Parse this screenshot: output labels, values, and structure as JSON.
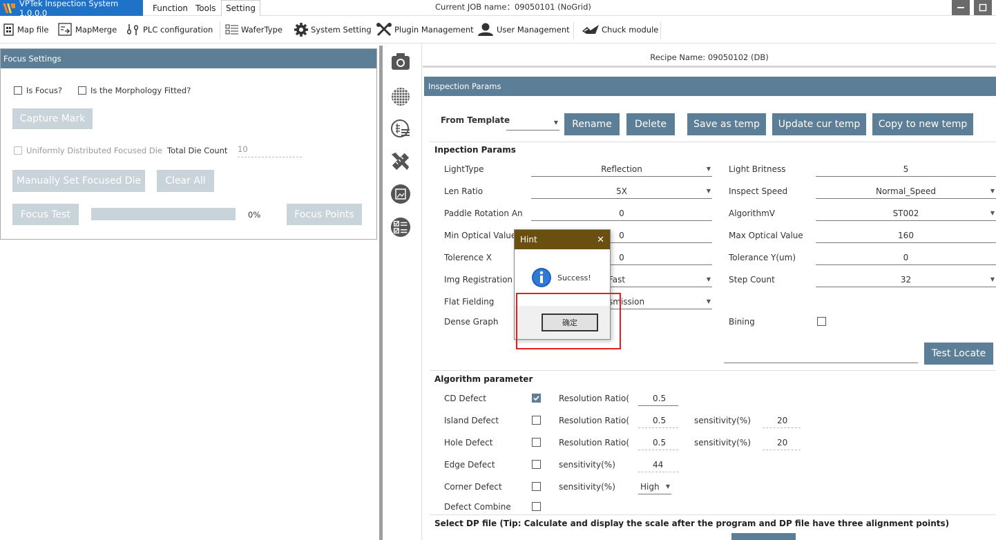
{
  "titlebar": {
    "app_name": "VPTek Inspection System 1.0.0.0",
    "menus": [
      "Function",
      "Tools",
      "Setting"
    ],
    "job_name": "Current JOB name：09050101 (NoGrid)"
  },
  "toolbar": {
    "items": [
      "Map file",
      "MapMerge",
      "PLC configuration",
      "WaferType",
      "System Setting",
      "Plugin Management",
      "User Management",
      "Chuck module"
    ]
  },
  "focus": {
    "header": "Focus Settings",
    "is_focus": "Is Focus?",
    "morphology": "Is the Morphology Fitted?",
    "capture_mark": "Capture Mark",
    "uniform": "Uniformly Distributed Focused Die",
    "total_die_label": "Total Die Count",
    "total_die_value": "10",
    "manual_set": "Manually Set Focused Die",
    "clear_all": "Clear All",
    "focus_test": "Focus Test",
    "progress_text": "0%",
    "progress": 0,
    "focus_points": "Focus Points"
  },
  "recipe_name": "Recipe Name: 09050102 (DB)",
  "inspection": {
    "header": "Inspection Params",
    "from_template": "From Template",
    "rename": "Rename",
    "delete": "Delete",
    "save_temp": "Save as temp",
    "update_temp": "Update cur temp",
    "copy_temp": "Copy to new temp",
    "section": "Inpection Params",
    "light_type": "LightType",
    "light_type_val": "Reflection",
    "light_brit": "Light Britness",
    "light_brit_val": "5",
    "len_ratio": "Len Ratio",
    "len_ratio_val": "5X",
    "inspect_speed": "Inspect Speed",
    "inspect_speed_val": "Normal_Speed",
    "paddle": "Paddle Rotation An",
    "paddle_val": "0",
    "algo_v": "AlgorithmV",
    "algo_v_val": "ST002",
    "min_opt": "Min Optical Value",
    "min_opt_val": "0",
    "max_opt": "Max Optical Value",
    "max_opt_val": "160",
    "tol_x": "Tolerence X",
    "tol_x_val": "0",
    "tol_y": "Tolerance Y(um)",
    "tol_y_val": "0",
    "img_reg": "Img Registration M",
    "img_reg_val": "Fast",
    "step_count": "Step Count",
    "step_count_val": "32",
    "flat_field": "Flat Fielding",
    "flat_field_val": "smission",
    "dense_graph": "Dense Graph",
    "bining": "Bining",
    "test_locate": "Test Locate"
  },
  "algorithm": {
    "section": "Algorithm parameter",
    "rows": [
      {
        "name": "CD Defect",
        "checked": true,
        "p1": "Resolution Ratio(",
        "v1": "0.5",
        "p2": "",
        "v2": ""
      },
      {
        "name": "Island Defect",
        "checked": false,
        "p1": "Resolution Ratio(",
        "v1": "0.5",
        "p2": "sensitivity(%)",
        "v2": "20"
      },
      {
        "name": "Hole Defect",
        "checked": false,
        "p1": "Resolution Ratio(",
        "v1": "0.5",
        "p2": "sensitivity(%)",
        "v2": "20"
      },
      {
        "name": "Edge Defect",
        "checked": false,
        "p1": "sensitivity(%)",
        "v1": "44",
        "p2": "",
        "v2": ""
      },
      {
        "name": "Corner Defect",
        "checked": false,
        "p1": "sensitivity(%)",
        "v1": "High",
        "p2": "",
        "v2": ""
      },
      {
        "name": "Defect Combine",
        "checked": false,
        "p1": "",
        "v1": "",
        "p2": "",
        "v2": ""
      }
    ]
  },
  "dp_tip": "Select DP file (Tip: Calculate and display the scale after the program and DP file have three alignment points)",
  "dialog": {
    "title": "Hint",
    "close": "✕",
    "message": "Success!",
    "ok": "确定"
  },
  "colors": {
    "accent": "#5c7f97",
    "app_tab": "#1e72c8",
    "dialog_title": "#6b4f10",
    "highlight": "#e41d1d"
  }
}
